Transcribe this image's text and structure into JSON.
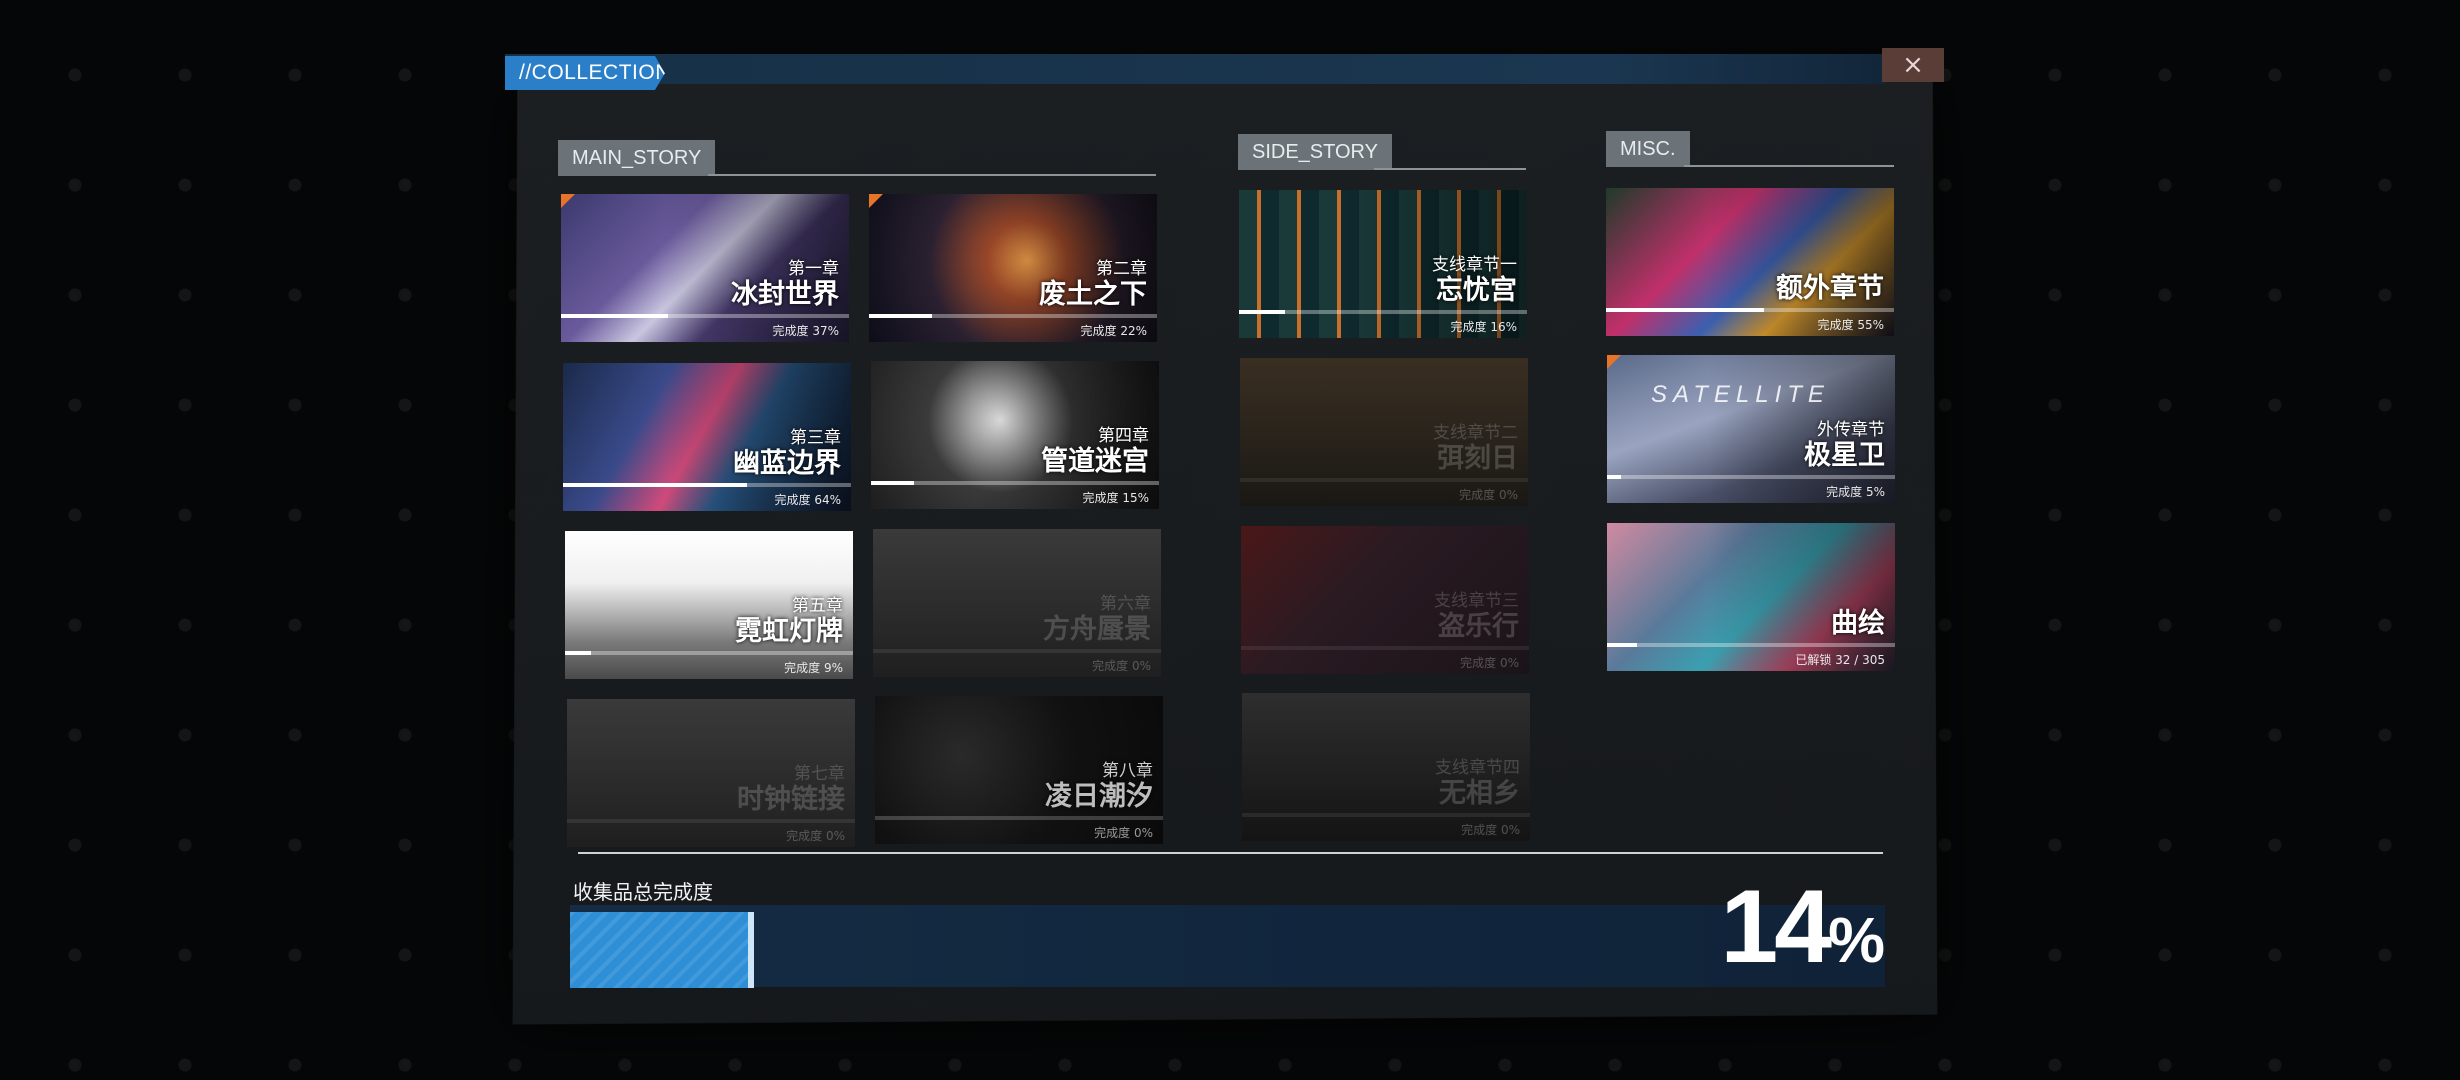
{
  "header": {
    "title": "//COLLECTION",
    "close_label": "×"
  },
  "sections": {
    "main": {
      "label": "MAIN_STORY"
    },
    "side": {
      "label": "SIDE_STORY"
    },
    "misc": {
      "label": "MISC."
    }
  },
  "main_story": [
    {
      "sub": "第一章",
      "name": "冰封世界",
      "progress": "完成度 37%",
      "fill": 0.37,
      "locked": false
    },
    {
      "sub": "第二章",
      "name": "废土之下",
      "progress": "完成度 22%",
      "fill": 0.22,
      "locked": false
    },
    {
      "sub": "第三章",
      "name": "幽蓝边界",
      "progress": "完成度 64%",
      "fill": 0.64,
      "locked": false
    },
    {
      "sub": "第四章",
      "name": "管道迷宫",
      "progress": "完成度 15%",
      "fill": 0.15,
      "locked": false
    },
    {
      "sub": "第五章",
      "name": "霓虹灯牌",
      "progress": "完成度 9%",
      "fill": 0.09,
      "locked": false
    },
    {
      "sub": "第六章",
      "name": "方舟蜃景",
      "progress": "完成度 0%",
      "fill": 0,
      "locked": true
    },
    {
      "sub": "第七章",
      "name": "时钟链接",
      "progress": "完成度 0%",
      "fill": 0,
      "locked": true
    },
    {
      "sub": "第八章",
      "name": "凌日潮汐",
      "progress": "完成度 0%",
      "fill": 0,
      "locked": false
    }
  ],
  "side_story": [
    {
      "sub": "支线章节一",
      "name": "忘忧宫",
      "progress": "完成度 16%",
      "fill": 0.16,
      "locked": false
    },
    {
      "sub": "支线章节二",
      "name": "弭刻日",
      "progress": "完成度 0%",
      "fill": 0,
      "locked": true
    },
    {
      "sub": "支线章节三",
      "name": "盗乐行",
      "progress": "完成度 0%",
      "fill": 0,
      "locked": true
    },
    {
      "sub": "支线章节四",
      "name": "无相乡",
      "progress": "完成度 0%",
      "fill": 0,
      "locked": true
    }
  ],
  "misc": [
    {
      "sub": "",
      "name": "额外章节",
      "progress": "完成度 55%",
      "fill": 0.55,
      "locked": false
    },
    {
      "sub": "外传章节",
      "name": "极星卫",
      "progress": "完成度 5%",
      "fill": 0.05,
      "locked": false,
      "overlay": "SATELLITE"
    },
    {
      "sub": "",
      "name": "曲绘",
      "progress": "已解锁 32 / 305",
      "fill": 0.105,
      "locked": false
    }
  ],
  "total": {
    "label": "收集品总完成度",
    "number": "14",
    "symbol": "%",
    "fill": 0.14
  },
  "colors": {
    "accent": "#2b7fc9",
    "bar_fill": "#2e8fd6",
    "close_bg": "#5a3d36"
  }
}
